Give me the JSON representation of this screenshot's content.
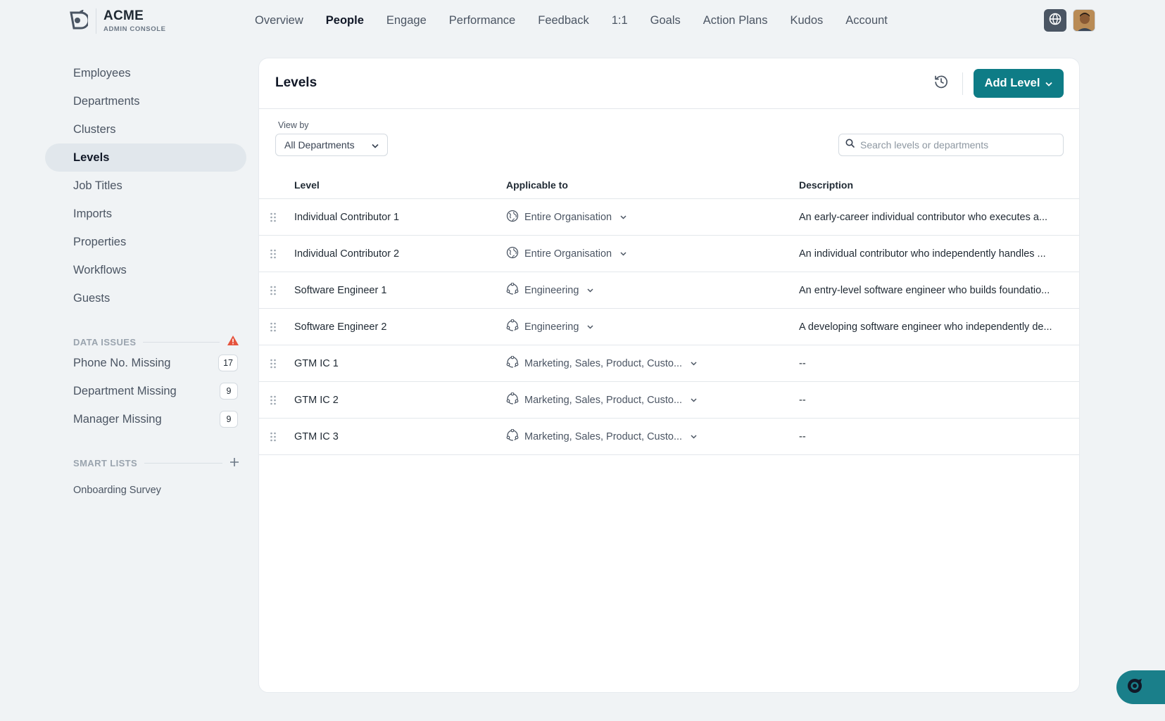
{
  "brand": {
    "name": "ACME",
    "subtitle": "ADMIN CONSOLE"
  },
  "nav": {
    "items": [
      {
        "label": "Overview",
        "active": false
      },
      {
        "label": "People",
        "active": true
      },
      {
        "label": "Engage",
        "active": false
      },
      {
        "label": "Performance",
        "active": false
      },
      {
        "label": "Feedback",
        "active": false
      },
      {
        "label": "1:1",
        "active": false
      },
      {
        "label": "Goals",
        "active": false
      },
      {
        "label": "Action Plans",
        "active": false
      },
      {
        "label": "Kudos",
        "active": false
      },
      {
        "label": "Account",
        "active": false
      }
    ]
  },
  "sidebar": {
    "items": [
      {
        "label": "Employees",
        "active": false
      },
      {
        "label": "Departments",
        "active": false
      },
      {
        "label": "Clusters",
        "active": false
      },
      {
        "label": "Levels",
        "active": true
      },
      {
        "label": "Job Titles",
        "active": false
      },
      {
        "label": "Imports",
        "active": false
      },
      {
        "label": "Properties",
        "active": false
      },
      {
        "label": "Workflows",
        "active": false
      },
      {
        "label": "Guests",
        "active": false
      }
    ],
    "data_issues": {
      "title": "DATA ISSUES",
      "items": [
        {
          "label": "Phone No. Missing",
          "count": "17"
        },
        {
          "label": "Department Missing",
          "count": "9"
        },
        {
          "label": "Manager Missing",
          "count": "9"
        }
      ]
    },
    "smart_lists": {
      "title": "SMART LISTS",
      "items": [
        {
          "label": "Onboarding Survey"
        }
      ]
    }
  },
  "main": {
    "title": "Levels",
    "add_button": "Add Level",
    "view_by": {
      "label": "View by",
      "value": "All Departments"
    },
    "search": {
      "placeholder": "Search levels or departments",
      "value": ""
    },
    "table": {
      "headers": {
        "level": "Level",
        "applicable": "Applicable to",
        "description": "Description"
      },
      "rows": [
        {
          "level": "Individual Contributor 1",
          "applicable": "Entire Organisation",
          "scope_icon": "globe-icon",
          "description": "An early-career individual contributor who executes a..."
        },
        {
          "level": "Individual Contributor 2",
          "applicable": "Entire Organisation",
          "scope_icon": "globe-icon",
          "description": "An individual contributor who independently handles ..."
        },
        {
          "level": "Software Engineer 1",
          "applicable": "Engineering",
          "scope_icon": "department-icon",
          "description": "An entry-level software engineer who builds foundatio..."
        },
        {
          "level": "Software Engineer 2",
          "applicable": "Engineering",
          "scope_icon": "department-icon",
          "description": "A developing software engineer who independently de..."
        },
        {
          "level": "GTM IC 1",
          "applicable": "Marketing, Sales, Product, Custo...",
          "scope_icon": "department-icon",
          "description": "--"
        },
        {
          "level": "GTM IC 2",
          "applicable": "Marketing, Sales, Product, Custo...",
          "scope_icon": "department-icon",
          "description": "--"
        },
        {
          "level": "GTM IC 3",
          "applicable": "Marketing, Sales, Product, Custo...",
          "scope_icon": "department-icon",
          "description": "--"
        }
      ]
    }
  },
  "colors": {
    "accent": "#0e7c86",
    "warning": "#e5533d",
    "background": "#f0f3f5",
    "active_nav_bg": "#e1e7ec"
  }
}
